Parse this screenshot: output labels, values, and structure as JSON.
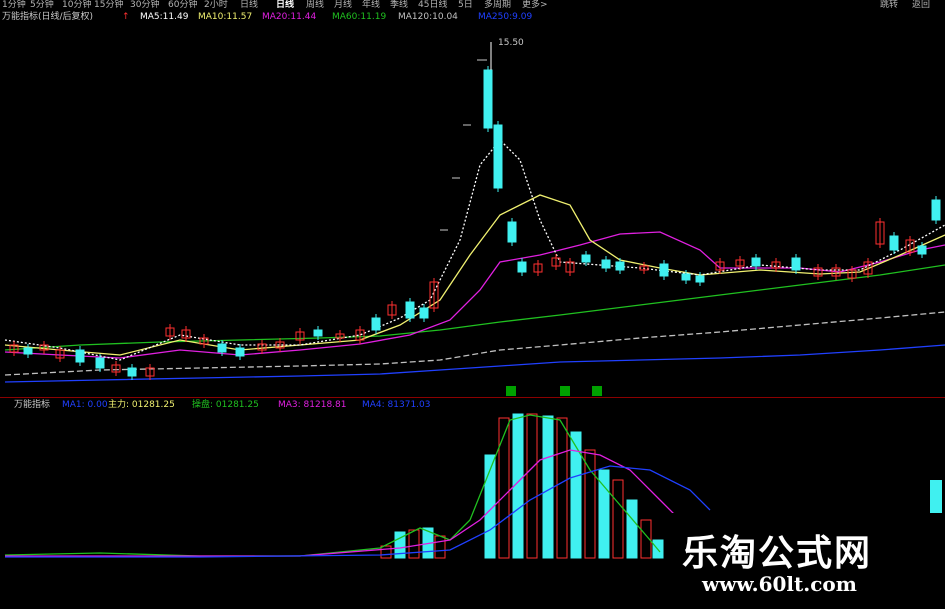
{
  "toolbar": {
    "periods": [
      "1分钟",
      "5分钟",
      "10分钟",
      "15分钟",
      "30分钟",
      "60分钟",
      "2小时",
      "日线",
      "周线",
      "月线",
      "年线",
      "季线",
      "45日线",
      "5日",
      "多周期",
      "更多>"
    ],
    "active_period": "日线",
    "right_buttons": [
      "跳转",
      "返回"
    ]
  },
  "main_legend": {
    "title": "万能指标(日线/后复权)",
    "ma5": "MA5:11.49",
    "ma10": "MA10:11.57",
    "ma20": "MA20:11.44",
    "ma60": "MA60:11.19",
    "ma120": "MA120:10.04",
    "ma250": "MA250:9.09"
  },
  "peak_label": "15.50",
  "sub_legend": {
    "title": "万能指标",
    "item1": "MA1: 0.00",
    "item2": "主力: 01281.25",
    "item3": "操盘: 01281.25",
    "item4": "MA3: 81218.81",
    "item5": "MA4: 81371.03"
  },
  "watermark": {
    "title": "乐淘公式网",
    "url": "www.60lt.com"
  },
  "colors": {
    "up": "#ff3030",
    "down": "#40f0f0",
    "ma5": "#ffffff",
    "ma10": "#f0f070",
    "ma20": "#e020e0",
    "ma60": "#20c020",
    "ma120": "#c0c0c0",
    "ma250": "#2040ff"
  }
}
